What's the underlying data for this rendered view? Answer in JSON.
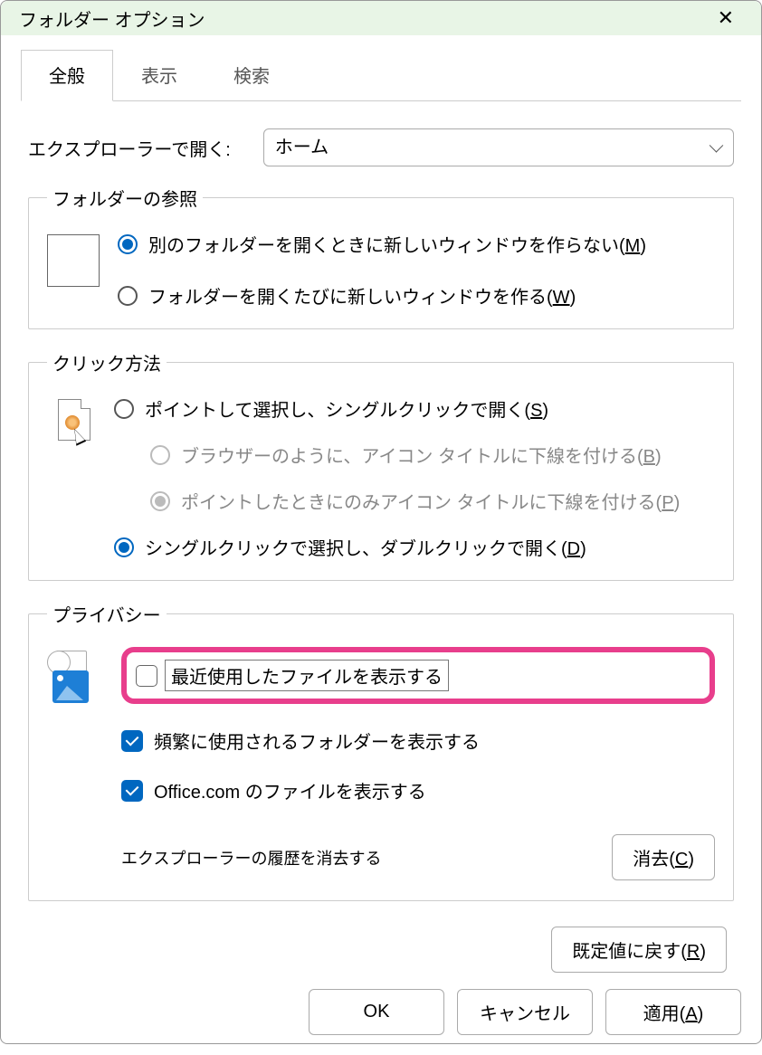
{
  "window": {
    "title": "フォルダー オプション"
  },
  "tabs": {
    "general": "全般",
    "view": "表示",
    "search": "検索"
  },
  "open_in": {
    "label": "エクスプローラーで開く:",
    "value": "ホーム"
  },
  "browse": {
    "legend": "フォルダーの参照",
    "opt1_pre": "別のフォルダーを開くときに新しいウィンドウを作らない(",
    "opt1_u": "M",
    "opt1_post": ")",
    "opt2_pre": "フォルダーを開くたびに新しいウィンドウを作る(",
    "opt2_u": "W",
    "opt2_post": ")"
  },
  "click": {
    "legend": "クリック方法",
    "opt1_pre": "ポイントして選択し、シングルクリックで開く(",
    "opt1_u": "S",
    "opt1_post": ")",
    "sub1_pre": "ブラウザーのように、アイコン タイトルに下線を付ける(",
    "sub1_u": "B",
    "sub1_post": ")",
    "sub2_pre": "ポイントしたときにのみアイコン タイトルに下線を付ける(",
    "sub2_u": "P",
    "sub2_post": ")",
    "opt2_pre": "シングルクリックで選択し、ダブルクリックで開く(",
    "opt2_u": "D",
    "opt2_post": ")"
  },
  "privacy": {
    "legend": "プライバシー",
    "recent": "最近使用したファイルを表示する",
    "frequent": "頻繁に使用されるフォルダーを表示する",
    "office": "Office.com のファイルを表示する",
    "clear_label": "エクスプローラーの履歴を消去する",
    "clear_btn_pre": "消去(",
    "clear_btn_u": "C",
    "clear_btn_post": ")"
  },
  "defaults": {
    "pre": "既定値に戻す(",
    "u": "R",
    "post": ")"
  },
  "footer": {
    "ok": "OK",
    "cancel": "キャンセル",
    "apply_pre": "適用(",
    "apply_u": "A",
    "apply_post": ")"
  }
}
